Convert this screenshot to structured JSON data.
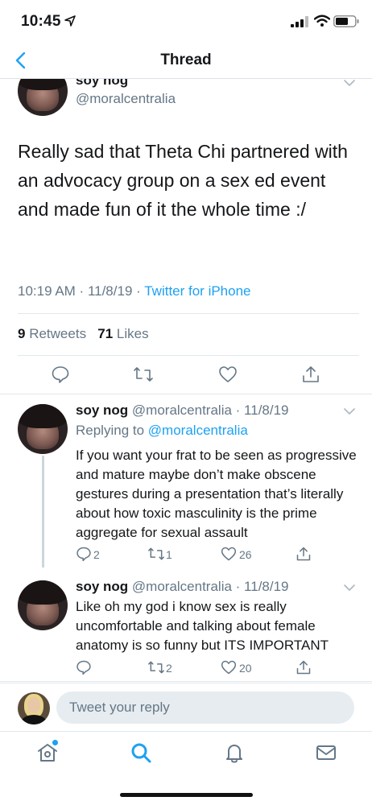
{
  "status_bar": {
    "time": "10:45"
  },
  "nav": {
    "title": "Thread"
  },
  "main_tweet": {
    "name": "soy nog",
    "handle": "@moralcentralia",
    "text": "Really sad that Theta Chi partnered with an advocacy group on a sex ed event and made fun of it the whole time :/",
    "time": "10:19 AM",
    "date": "11/8/19",
    "source": "Twitter for iPhone",
    "retweets_count": "9",
    "retweets_label": "Retweets",
    "likes_count": "71",
    "likes_label": "Likes"
  },
  "replies": [
    {
      "name": "soy nog",
      "handle": "@moralcentralia",
      "date": "11/8/19",
      "replying_label": "Replying to",
      "replying_to": "@moralcentralia",
      "text": "If you want your frat to be seen as progressive and mature maybe don’t make obscene gestures during a presentation that’s literally about how toxic masculinity is the prime aggregate for sexual assault",
      "replies": "2",
      "retweets": "1",
      "likes": "26"
    },
    {
      "name": "soy nog",
      "handle": "@moralcentralia",
      "date": "11/8/19",
      "text": "Like oh my god i know sex is really uncomfortable and talking about female anatomy is so funny but ITS IMPORTANT",
      "replies": "",
      "retweets": "2",
      "likes": "20"
    }
  ],
  "reply_bar": {
    "placeholder": "Tweet your reply"
  },
  "tabs": [
    "home-icon",
    "search-icon",
    "notifications-icon",
    "messages-icon"
  ],
  "colors": {
    "accent": "#1da1f2",
    "secondary_text": "#657786",
    "divider": "#e1e8ed"
  }
}
